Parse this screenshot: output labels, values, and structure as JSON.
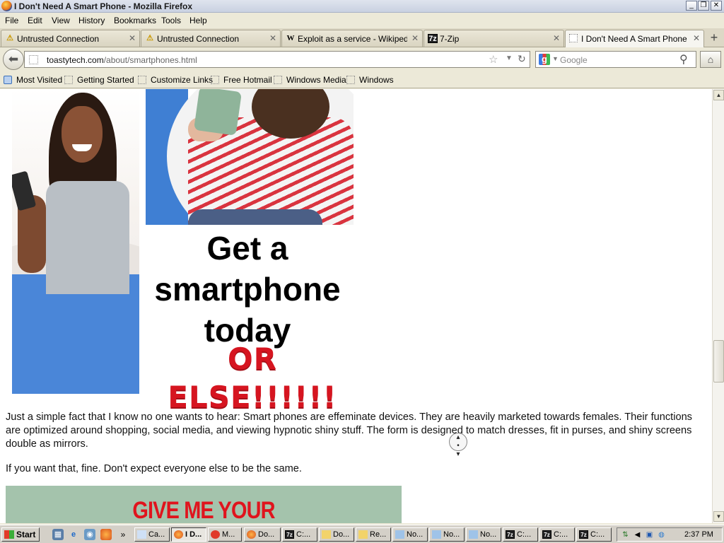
{
  "window": {
    "title": "I Don't Need A Smart Phone - Mozilla Firefox",
    "buttons": {
      "minimize": "_",
      "maximize": "❐",
      "close": "✕"
    }
  },
  "menu": [
    "File",
    "Edit",
    "View",
    "History",
    "Bookmarks",
    "Tools",
    "Help"
  ],
  "tabs": [
    {
      "label": "Untrusted Connection",
      "icon": "warning-icon"
    },
    {
      "label": "Untrusted Connection",
      "icon": "warning-icon"
    },
    {
      "label": "Exploit as a service - Wikipedia",
      "icon": "wikipedia-icon"
    },
    {
      "label": "7-Zip",
      "icon": "7zip-icon"
    },
    {
      "label": "I Don't Need A Smart Phone",
      "icon": "blank-page-icon",
      "active": true
    }
  ],
  "nav": {
    "url_host": "toastytech.com",
    "url_path": "/about/smartphones.html",
    "search_placeholder": "Google"
  },
  "bookmarks": [
    "Most Visited",
    "Getting Started",
    "Customize Links",
    "Free Hotmail",
    "Windows Media",
    "Windows"
  ],
  "page": {
    "headline": "Get a smartphone today",
    "or_else": "OR ELSE!!!!!!",
    "paragraph1": "Just a simple fact that I know no one wants to hear: Smart phones are effeminate devices. They are heavily marketed towards females. Their functions are optimized around shopping, social media, and viewing hypnotic shiny stuff. The form is designed to match dresses, fit in purses, and shiny screens double as mirrors.",
    "paragraph2": "If you want that, fine. Don't expect everyone else to be the same.",
    "banner_text": "GIVE ME YOUR CELLPHOOOONES!!"
  },
  "taskbar": {
    "start": "Start",
    "tasks": [
      "Ca...",
      "I D...",
      "M...",
      "Do...",
      "C:...",
      "Do...",
      "Re...",
      "No...",
      "No...",
      "No...",
      "C:...",
      "C:...",
      "C:..."
    ],
    "clock": "2:37 PM",
    "overflow": "»"
  },
  "colors": {
    "accent_red": "#d61520",
    "blue_panel": "#4a86d8",
    "banner_bg": "#a4c3ac"
  }
}
